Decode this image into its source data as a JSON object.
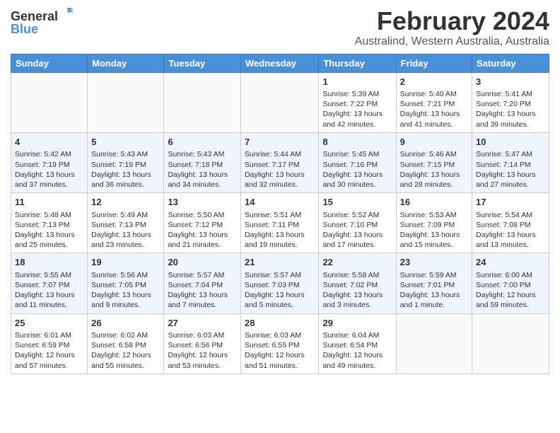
{
  "logo": {
    "general": "General",
    "blue": "Blue"
  },
  "title": "February 2024",
  "subtitle": "Australind, Western Australia, Australia",
  "days": [
    "Sunday",
    "Monday",
    "Tuesday",
    "Wednesday",
    "Thursday",
    "Friday",
    "Saturday"
  ],
  "weeks": [
    [
      {
        "num": "",
        "data": ""
      },
      {
        "num": "",
        "data": ""
      },
      {
        "num": "",
        "data": ""
      },
      {
        "num": "",
        "data": ""
      },
      {
        "num": "1",
        "data": "Sunrise: 5:39 AM\nSunset: 7:22 PM\nDaylight: 13 hours\nand 42 minutes."
      },
      {
        "num": "2",
        "data": "Sunrise: 5:40 AM\nSunset: 7:21 PM\nDaylight: 13 hours\nand 41 minutes."
      },
      {
        "num": "3",
        "data": "Sunrise: 5:41 AM\nSunset: 7:20 PM\nDaylight: 13 hours\nand 39 minutes."
      }
    ],
    [
      {
        "num": "4",
        "data": "Sunrise: 5:42 AM\nSunset: 7:19 PM\nDaylight: 13 hours\nand 37 minutes."
      },
      {
        "num": "5",
        "data": "Sunrise: 5:43 AM\nSunset: 7:19 PM\nDaylight: 13 hours\nand 36 minutes."
      },
      {
        "num": "6",
        "data": "Sunrise: 5:43 AM\nSunset: 7:18 PM\nDaylight: 13 hours\nand 34 minutes."
      },
      {
        "num": "7",
        "data": "Sunrise: 5:44 AM\nSunset: 7:17 PM\nDaylight: 13 hours\nand 32 minutes."
      },
      {
        "num": "8",
        "data": "Sunrise: 5:45 AM\nSunset: 7:16 PM\nDaylight: 13 hours\nand 30 minutes."
      },
      {
        "num": "9",
        "data": "Sunrise: 5:46 AM\nSunset: 7:15 PM\nDaylight: 13 hours\nand 28 minutes."
      },
      {
        "num": "10",
        "data": "Sunrise: 5:47 AM\nSunset: 7:14 PM\nDaylight: 13 hours\nand 27 minutes."
      }
    ],
    [
      {
        "num": "11",
        "data": "Sunrise: 5:48 AM\nSunset: 7:13 PM\nDaylight: 13 hours\nand 25 minutes."
      },
      {
        "num": "12",
        "data": "Sunrise: 5:49 AM\nSunset: 7:13 PM\nDaylight: 13 hours\nand 23 minutes."
      },
      {
        "num": "13",
        "data": "Sunrise: 5:50 AM\nSunset: 7:12 PM\nDaylight: 13 hours\nand 21 minutes."
      },
      {
        "num": "14",
        "data": "Sunrise: 5:51 AM\nSunset: 7:11 PM\nDaylight: 13 hours\nand 19 minutes."
      },
      {
        "num": "15",
        "data": "Sunrise: 5:52 AM\nSunset: 7:10 PM\nDaylight: 13 hours\nand 17 minutes."
      },
      {
        "num": "16",
        "data": "Sunrise: 5:53 AM\nSunset: 7:09 PM\nDaylight: 13 hours\nand 15 minutes."
      },
      {
        "num": "17",
        "data": "Sunrise: 5:54 AM\nSunset: 7:08 PM\nDaylight: 13 hours\nand 13 minutes."
      }
    ],
    [
      {
        "num": "18",
        "data": "Sunrise: 5:55 AM\nSunset: 7:07 PM\nDaylight: 13 hours\nand 11 minutes."
      },
      {
        "num": "19",
        "data": "Sunrise: 5:56 AM\nSunset: 7:05 PM\nDaylight: 13 hours\nand 9 minutes."
      },
      {
        "num": "20",
        "data": "Sunrise: 5:57 AM\nSunset: 7:04 PM\nDaylight: 13 hours\nand 7 minutes."
      },
      {
        "num": "21",
        "data": "Sunrise: 5:57 AM\nSunset: 7:03 PM\nDaylight: 13 hours\nand 5 minutes."
      },
      {
        "num": "22",
        "data": "Sunrise: 5:58 AM\nSunset: 7:02 PM\nDaylight: 13 hours\nand 3 minutes."
      },
      {
        "num": "23",
        "data": "Sunrise: 5:59 AM\nSunset: 7:01 PM\nDaylight: 13 hours\nand 1 minute."
      },
      {
        "num": "24",
        "data": "Sunrise: 6:00 AM\nSunset: 7:00 PM\nDaylight: 12 hours\nand 59 minutes."
      }
    ],
    [
      {
        "num": "25",
        "data": "Sunrise: 6:01 AM\nSunset: 6:59 PM\nDaylight: 12 hours\nand 57 minutes."
      },
      {
        "num": "26",
        "data": "Sunrise: 6:02 AM\nSunset: 6:58 PM\nDaylight: 12 hours\nand 55 minutes."
      },
      {
        "num": "27",
        "data": "Sunrise: 6:03 AM\nSunset: 6:56 PM\nDaylight: 12 hours\nand 53 minutes."
      },
      {
        "num": "28",
        "data": "Sunrise: 6:03 AM\nSunset: 6:55 PM\nDaylight: 12 hours\nand 51 minutes."
      },
      {
        "num": "29",
        "data": "Sunrise: 6:04 AM\nSunset: 6:54 PM\nDaylight: 12 hours\nand 49 minutes."
      },
      {
        "num": "",
        "data": ""
      },
      {
        "num": "",
        "data": ""
      }
    ]
  ]
}
